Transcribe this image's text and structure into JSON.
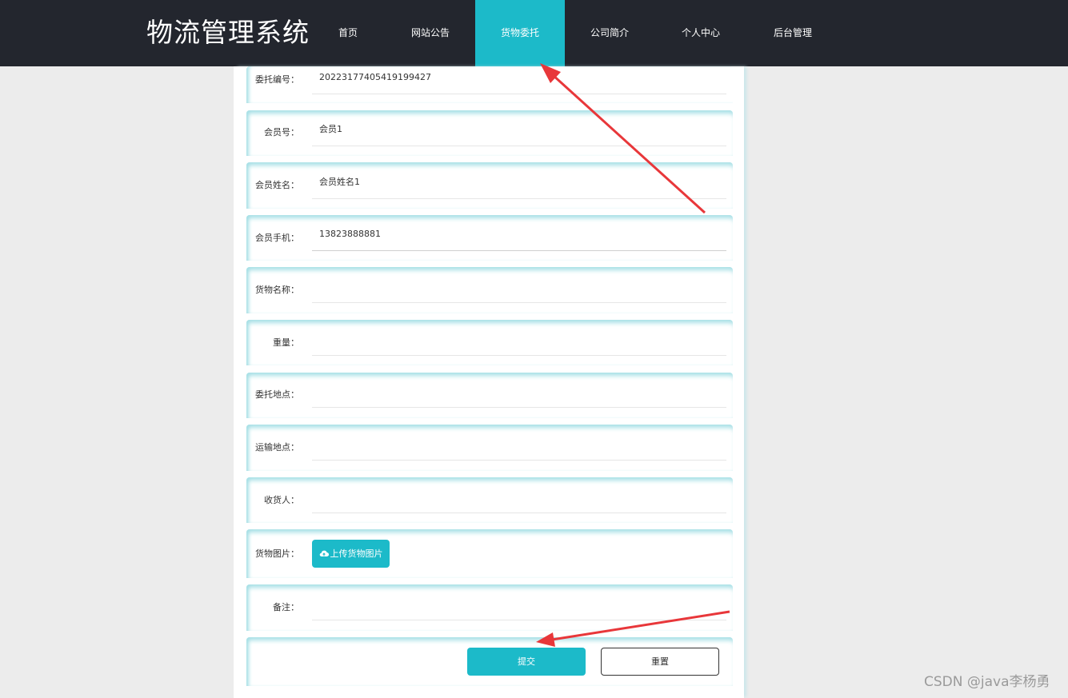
{
  "header": {
    "brand": "物流管理系统",
    "nav": [
      {
        "label": "首页",
        "active": false
      },
      {
        "label": "网站公告",
        "active": false
      },
      {
        "label": "货物委托",
        "active": true
      },
      {
        "label": "公司简介",
        "active": false
      },
      {
        "label": "个人中心",
        "active": false
      },
      {
        "label": "后台管理",
        "active": false
      }
    ]
  },
  "form": {
    "fields": [
      {
        "label": "委托编号：",
        "value": "20223177405419199427"
      },
      {
        "label": "会员号：",
        "value": "会员1"
      },
      {
        "label": "会员姓名：",
        "value": "会员姓名1"
      },
      {
        "label": "会员手机：",
        "value": "13823888881"
      },
      {
        "label": "货物名称：",
        "value": ""
      },
      {
        "label": "重量：",
        "value": ""
      },
      {
        "label": "委托地点：",
        "value": ""
      },
      {
        "label": "运输地点：",
        "value": ""
      },
      {
        "label": "收货人：",
        "value": ""
      }
    ],
    "image_label": "货物图片：",
    "upload_label": "上传货物图片",
    "upload_icon": "cloud-upload-icon",
    "note_label": "备注：",
    "note_value": "",
    "submit_label": "提交",
    "reset_label": "重置"
  },
  "colors": {
    "header_bg": "#23262e",
    "accent": "#1cbac9",
    "page_bg": "#ececec",
    "annotation_arrow": "#e8373a"
  },
  "watermark": "CSDN @java李杨勇"
}
